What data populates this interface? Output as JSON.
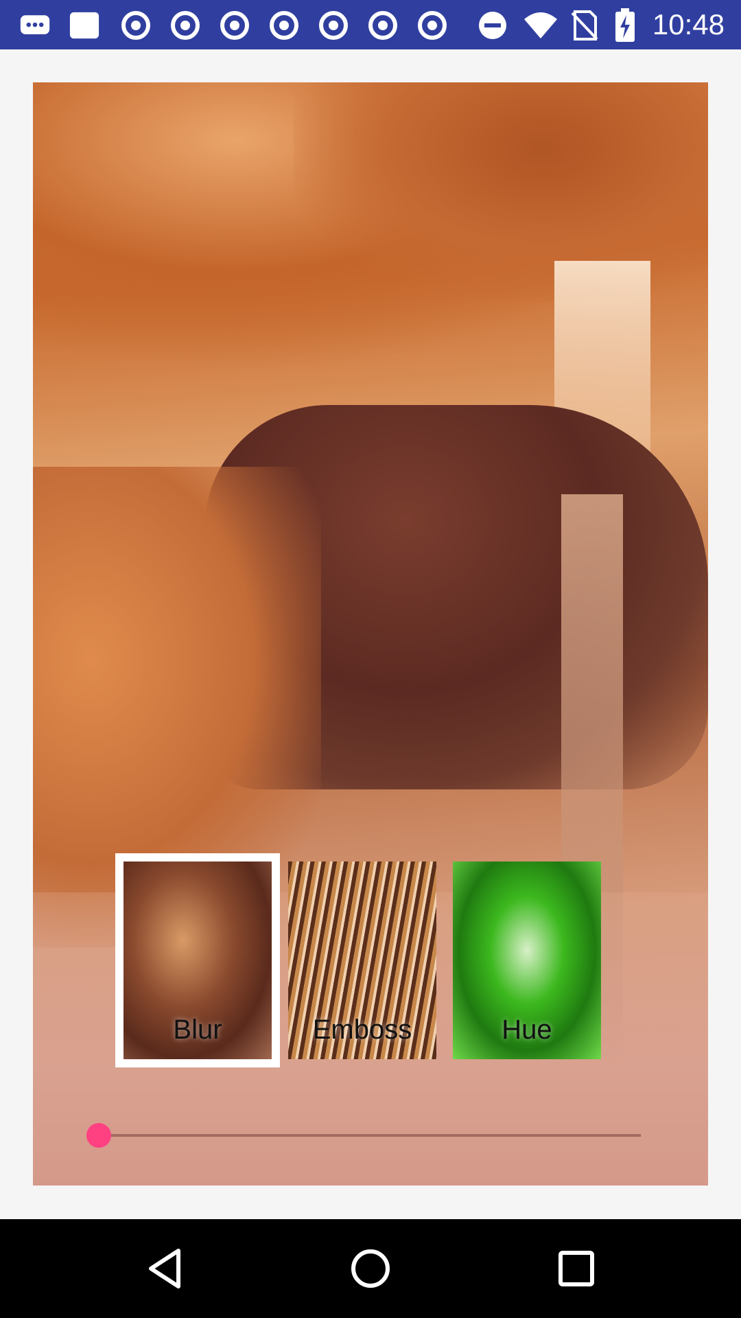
{
  "status_bar": {
    "time": "10:48",
    "notification_icons": [
      "messages-icon",
      "message-icon",
      "chrome-icon",
      "chrome-icon",
      "chrome-icon",
      "chrome-icon",
      "chrome-icon",
      "chrome-icon",
      "chrome-icon"
    ],
    "system_icons": [
      "do-not-disturb-icon",
      "wifi-icon",
      "battery-icon"
    ]
  },
  "filters": {
    "items": [
      {
        "label": "Blur",
        "selected": true
      },
      {
        "label": "Emboss",
        "selected": false
      },
      {
        "label": "Hue",
        "selected": false
      }
    ]
  },
  "slider": {
    "value": 0
  },
  "colors": {
    "status_bar": "#303f9f",
    "accent": "#ff4081",
    "nav_bar": "#000000"
  },
  "nav_bar": {
    "buttons": [
      "back-icon",
      "home-icon",
      "recents-icon"
    ]
  }
}
